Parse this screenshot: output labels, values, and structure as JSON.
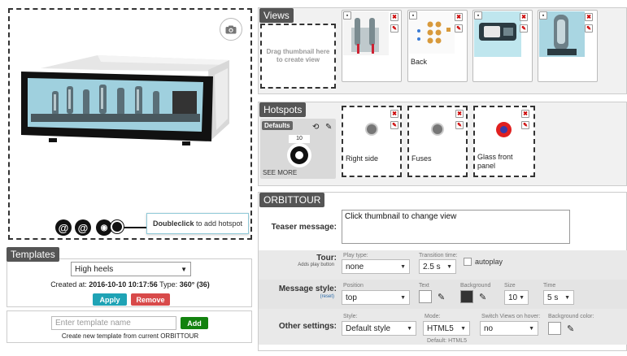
{
  "preview": {
    "hotspot_hint_bold": "Doubleclick",
    "hotspot_hint_rest": " to add hotspot"
  },
  "templates": {
    "title": "Templates",
    "selected": "High heels",
    "created_label": "Created at:",
    "created_value": "2016-10-10 10:17:56",
    "type_label": "Type:",
    "type_value": "360° (36)",
    "apply_label": "Apply",
    "remove_label": "Remove",
    "new_placeholder": "Enter template name",
    "add_label": "Add",
    "new_caption": "Create new template from current ORBITTOUR"
  },
  "views": {
    "title": "Views",
    "dropzone_text": "Drag thumbnail here to create view",
    "items": [
      {
        "label": ""
      },
      {
        "label": "Back"
      },
      {
        "label": ""
      },
      {
        "label": ""
      }
    ]
  },
  "hotspots": {
    "title": "Hotspots",
    "defaults_label": "Defaults",
    "default_number": "10",
    "see_more": "SEE MORE",
    "items": [
      {
        "label": "Right side",
        "color": "#888888"
      },
      {
        "label": "Fuses",
        "color": "#888888"
      },
      {
        "label": "Glass front panel",
        "color": "#e02020"
      }
    ]
  },
  "orbittour": {
    "title": "ORBITTOUR",
    "teaser_label": "Teaser message:",
    "teaser_value": "Click thumbnail to change view",
    "tour_label": "Tour:",
    "tour_sub": "Adds play button",
    "play_type_cap": "Play type:",
    "play_type_value": "none",
    "transition_cap": "Transition time:",
    "transition_value": "2.5 s",
    "autoplay_label": "autoplay",
    "msg_style_label": "Message style:",
    "msg_style_reset": "(reset)",
    "position_cap": "Position",
    "position_value": "top",
    "text_cap": "Text",
    "background_cap": "Background",
    "size_cap": "Size",
    "size_value": "10",
    "time_cap": "Time",
    "time_value": "5 s",
    "other_label": "Other settings:",
    "style_cap": "Style:",
    "style_value": "Default style",
    "mode_cap": "Mode:",
    "mode_value": "HTML5",
    "mode_default": "Default: HTML5",
    "switch_cap": "Switch Views on hover:",
    "switch_value": "no",
    "bgcolor_cap": "Background color:"
  },
  "colors": {
    "apply": "#1fa3b5",
    "remove": "#d84a4a",
    "add": "#13820f"
  }
}
